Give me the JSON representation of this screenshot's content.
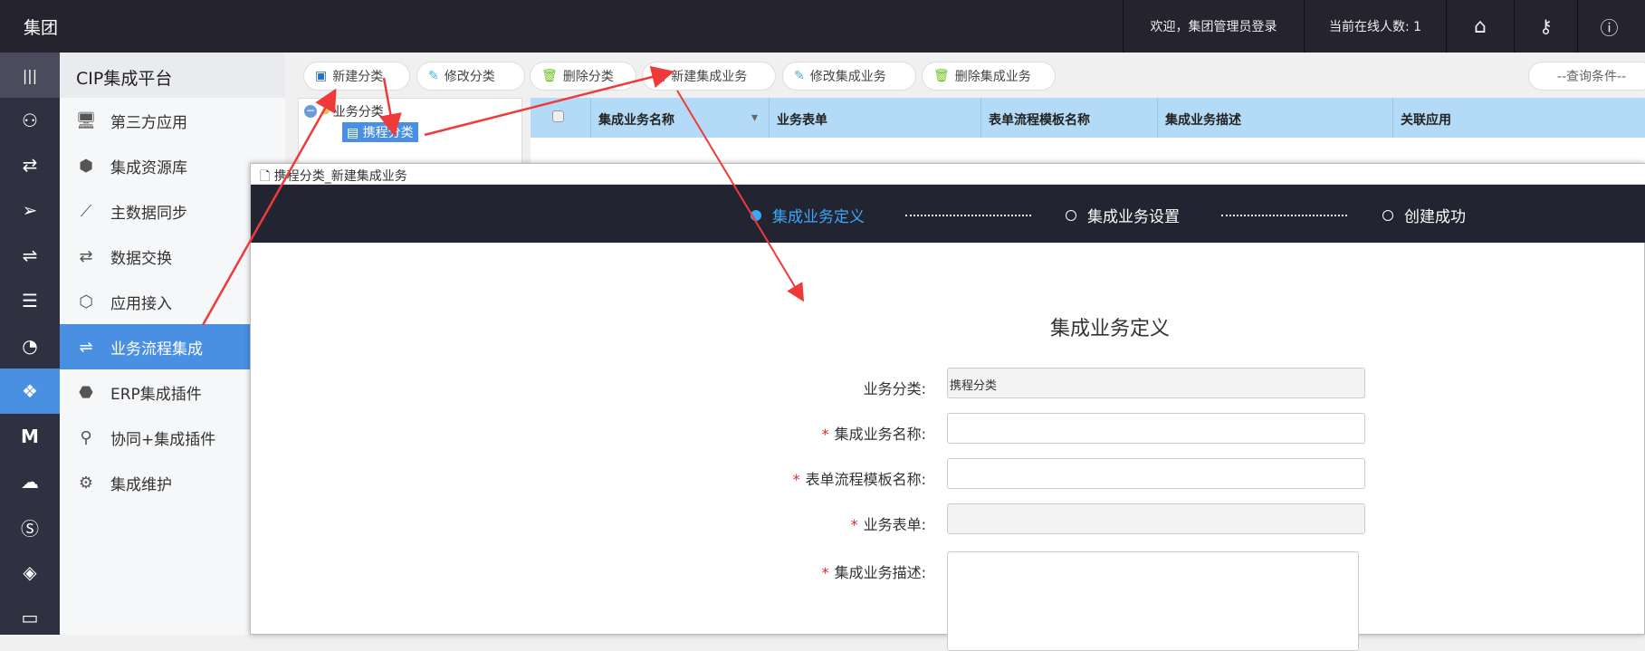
{
  "header": {
    "brand": "集团",
    "welcome": "欢迎，集团管理员登录",
    "online": "当前在线人数: 1"
  },
  "menu": {
    "title": "CIP集成平台",
    "items": [
      {
        "label": "第三方应用",
        "icon": "🖥"
      },
      {
        "label": "集成资源库",
        "icon": "⬢"
      },
      {
        "label": "主数据同步",
        "icon": "⟋"
      },
      {
        "label": "数据交换",
        "icon": "⇄"
      },
      {
        "label": "应用接入",
        "icon": "⬡"
      },
      {
        "label": "业务流程集成",
        "icon": "⇌"
      },
      {
        "label": "ERP集成插件",
        "icon": "⬣"
      },
      {
        "label": "协同+集成插件",
        "icon": "⚲"
      },
      {
        "label": "集成维护",
        "icon": "⚙"
      }
    ],
    "active": 5
  },
  "toolbar": {
    "new_category": "新建分类",
    "edit_category": "修改分类",
    "delete_category": "删除分类",
    "new_business": "新建集成业务",
    "edit_business": "修改集成业务",
    "delete_business": "删除集成业务",
    "query": "--查询条件--"
  },
  "tree": {
    "root": "业务分类",
    "child": "携程分类"
  },
  "grid": {
    "columns": [
      "集成业务名称",
      "业务表单",
      "表单流程模板名称",
      "集成业务描述",
      "关联应用"
    ]
  },
  "dialog": {
    "title": "携程分类_新建集成业务",
    "steps": [
      "集成业务定义",
      "集成业务设置",
      "创建成功"
    ],
    "form_title": "集成业务定义",
    "fields": [
      {
        "label": "业务分类:",
        "value": "携程分类",
        "required": false
      },
      {
        "label": "集成业务名称:",
        "value": "",
        "required": true
      },
      {
        "label": "表单流程模板名称:",
        "value": "",
        "required": true
      },
      {
        "label": "业务表单:",
        "value": "",
        "required": true
      },
      {
        "label": "集成业务描述:",
        "value": "",
        "required": true
      }
    ]
  },
  "colors": {
    "accent": "#4a90e2",
    "step_active": "#3ba7f5",
    "header": "#24232e",
    "annotation": "#f03a3a"
  }
}
